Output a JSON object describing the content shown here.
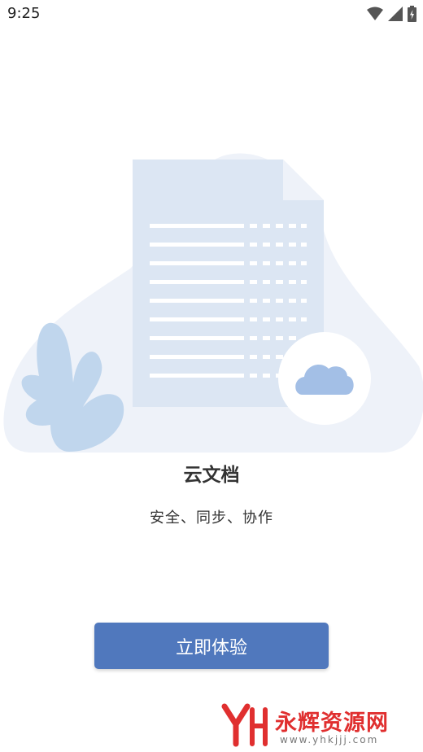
{
  "status_bar": {
    "time": "9:25",
    "icons": [
      "wifi-icon",
      "cellular-signal-icon",
      "battery-charging-icon"
    ]
  },
  "illustration": {
    "name": "cloud-document-illustration",
    "colors": {
      "blob": "#eef2f9",
      "document": "#dce6f3",
      "lines": "#ffffff",
      "cloud": "#a3bfe6",
      "leaf": "#c0d6ed"
    }
  },
  "onboarding": {
    "title": "云文档",
    "subtitle": "安全、同步、协作"
  },
  "cta": {
    "label": "立即体验",
    "color": "#5078bd"
  },
  "watermark": {
    "text": "永辉资源网",
    "url": "www.yhkjjj.com",
    "color": "#e02f2f"
  }
}
